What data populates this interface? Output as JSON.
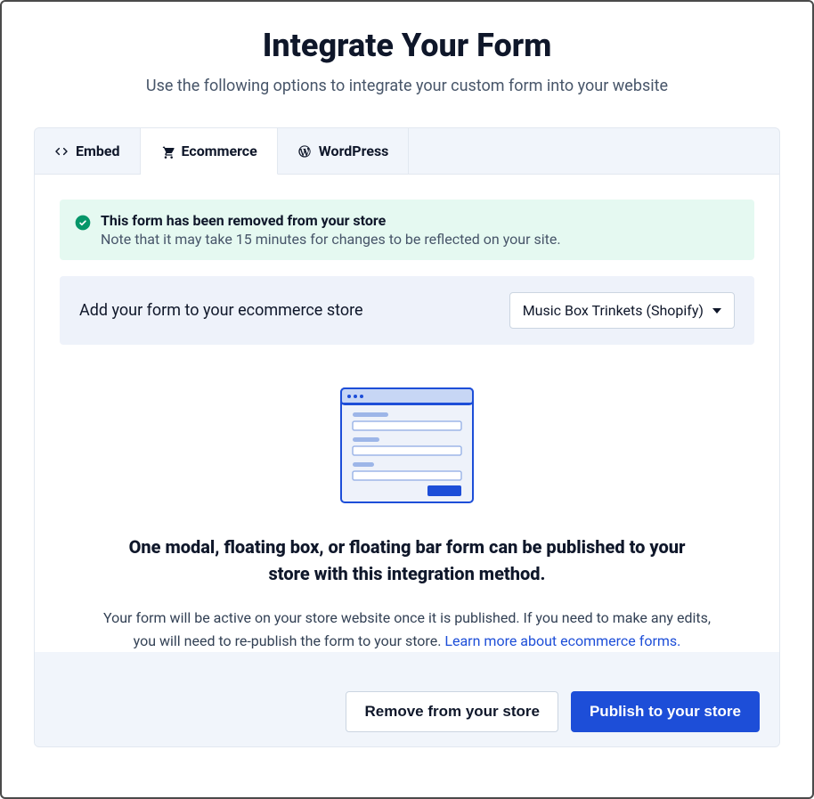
{
  "header": {
    "title": "Integrate Your Form",
    "subtitle": "Use the following options to integrate your custom form into your website"
  },
  "tabs": {
    "embed": "Embed",
    "ecommerce": "Ecommerce",
    "wordpress": "WordPress"
  },
  "alert": {
    "title": "This form has been removed from your store",
    "note": "Note that it may take 15 minutes for changes to be reflected on your site."
  },
  "store": {
    "label": "Add your form to your ecommerce store",
    "selected": "Music Box Trinkets (Shopify)"
  },
  "info": {
    "heading": "One modal, floating box, or floating bar form can be published to your store with this integration method.",
    "body_a": "Your form will be active on your store website once it is published. If you need to make any edits, you will need to re-publish the form to your store. ",
    "link": "Learn more about ecommerce forms."
  },
  "footer": {
    "remove": "Remove from your store",
    "publish": "Publish to your store"
  }
}
